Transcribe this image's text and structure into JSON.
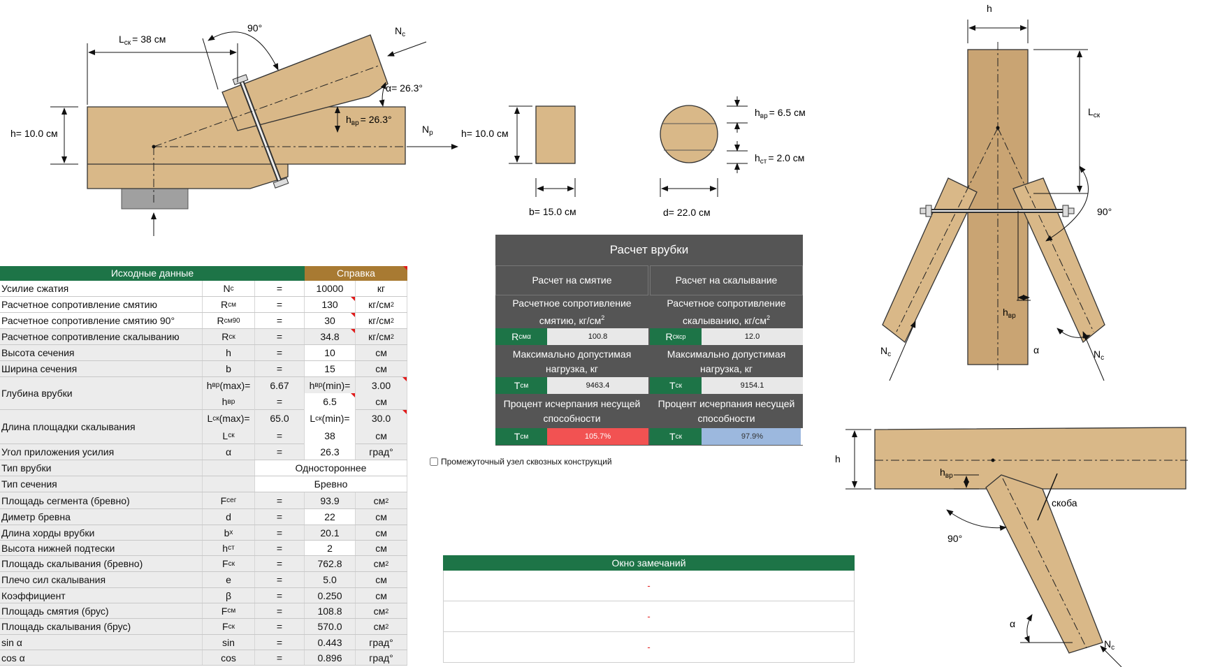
{
  "drawing1": {
    "l_label": "L",
    "l_sub": "ск",
    "l_value": "= 38 см",
    "angle_90": "90°",
    "nc": "N",
    "nc_sub": "c",
    "alpha": "α= 26.3°",
    "h_label": "h=  10.0 см",
    "hvr_label": "h",
    "hvr_sub": "вр",
    "hvr_value": "= 26.3°",
    "np": "N",
    "np_sub": "р"
  },
  "sections": {
    "rect_h": "h=  10.0 см",
    "rect_b": "b= 15.0 см",
    "circle_d": "d= 22.0 см",
    "hvr": "h",
    "hvr_sub": "вр",
    "hvr_value": "= 6.5 см",
    "hst": "h",
    "hst_sub": "ст",
    "hst_value": "= 2.0 см"
  },
  "drawing3": {
    "h": "h",
    "lsk": "L",
    "lsk_sub": "ск",
    "angle": "90°",
    "hvr": "h",
    "hvr_sub": "вр",
    "alpha": "α",
    "nc_left": "N",
    "nc_right": "N",
    "nc_sub": "c"
  },
  "drawing4": {
    "h": "h",
    "hvr": "h",
    "hvr_sub": "вр",
    "skoba": "скоба",
    "angle": "90°",
    "alpha": "α",
    "nc": "N",
    "nc_sub": "c"
  },
  "input": {
    "header": "Исходные данные",
    "help": "Справка",
    "colors": {
      "green": "#1d7447",
      "brown": "#a87a32"
    },
    "rows": {
      "force": {
        "label": "Усилие сжатия",
        "sym": "N",
        "sub": "c",
        "eq": "=",
        "val": "10000",
        "unit": "кг"
      },
      "rsm": {
        "label": "Расчетное сопротивление смятию",
        "sym": "R",
        "sub": "см",
        "eq": "=",
        "val": "130",
        "unit": "кг/см",
        "sup": "2"
      },
      "rsm90": {
        "label": "Расчетное сопротивление смятию 90°",
        "sym": "R",
        "sub": "см90",
        "eq": "=",
        "val": "30",
        "unit": "кг/см",
        "sup": "2"
      },
      "rsk": {
        "label": "Расчетное сопротивление скалыванию",
        "sym": "R",
        "sub": "ск",
        "eq": "=",
        "val": "34.8",
        "unit": "кг/см",
        "sup": "2"
      },
      "h": {
        "label": "Высота сечения",
        "sym": "h",
        "eq": "=",
        "val": "10",
        "unit": "см"
      },
      "b": {
        "label": "Ширина сечения",
        "sym": "b",
        "eq": "=",
        "val": "15",
        "unit": "см"
      },
      "depth": {
        "label": "Глубина врубки",
        "max_sym": "h",
        "max_sub": "вр",
        "max_suffix": "(max)=",
        "max_val": "6.67",
        "min_sym": "h",
        "min_sub": "вр",
        "min_suffix": "(min)=",
        "min_val": "3.00",
        "sym": "h",
        "sub": "вр",
        "eq": "=",
        "val": "6.5",
        "unit": "см"
      },
      "shear_len": {
        "label": "Длина площадки скалывания",
        "max_sym": "L",
        "max_sub": "ск",
        "max_suffix": "(max)=",
        "max_val": "65.0",
        "min_sym": "L",
        "min_sub": "ск",
        "min_suffix": "(min)=",
        "min_val": "30.0",
        "sym": "L",
        "sub": "ск",
        "eq": "=",
        "val": "38",
        "unit": "см"
      },
      "angle": {
        "label": "Угол приложения усилия",
        "sym": "α",
        "eq": "=",
        "val": "26.3",
        "unit": "град°"
      },
      "cut_type": {
        "label": "Тип врубки",
        "val": "Одностороннее"
      },
      "sec_type": {
        "label": "Тип сечения",
        "val": "Бревно"
      },
      "fseg": {
        "label": "Площадь сегмента (бревно)",
        "sym": "F",
        "sub": "сег",
        "eq": "=",
        "val": "93.9",
        "unit": "см",
        "sup": "2"
      },
      "d": {
        "label": "Диметр бревна",
        "sym": "d",
        "eq": "=",
        "val": "22",
        "unit": "см"
      },
      "bx": {
        "label": "Длина хорды врубки",
        "sym": "b",
        "sub": "x",
        "eq": "=",
        "val": "20.1",
        "unit": "см"
      },
      "hst": {
        "label": "Высота нижней подтески",
        "sym": "h",
        "sub": "ст",
        "eq": "=",
        "val": "2",
        "unit": "см"
      },
      "fsk_log": {
        "label": "Площадь скалывания (бревно)",
        "sym": "F",
        "sub": "ск",
        "eq": "=",
        "val": "762.8",
        "unit": "см",
        "sup": "2"
      },
      "e": {
        "label": "Плечо сил скалывания",
        "sym": "e",
        "eq": "=",
        "val": "5.0",
        "unit": "см"
      },
      "beta": {
        "label": "Коэффициент",
        "sym": "β",
        "eq": "=",
        "val": "0.250",
        "unit": "см"
      },
      "fsm": {
        "label": "Площадь смятия (брус)",
        "sym": "F",
        "sub": "см",
        "eq": "=",
        "val": "108.8",
        "unit": "см",
        "sup": "2"
      },
      "fsk_beam": {
        "label": "Площадь скалывания (брус)",
        "sym": "F",
        "sub": "ск",
        "eq": "=",
        "val": "570.0",
        "unit": "см",
        "sup": "2"
      },
      "sin": {
        "label": "sin α",
        "sym": "sin",
        "eq": "=",
        "val": "0.443",
        "unit": "град°"
      },
      "cos": {
        "label": "cos α",
        "sym": "cos",
        "eq": "=",
        "val": "0.896",
        "unit": "град°"
      }
    }
  },
  "calc": {
    "title": "Расчет врубки",
    "col1": "Расчет на смятие",
    "col2": "Расчет на скалывание",
    "res1_l1": "Расчетное сопротивление",
    "res1_l2": "смятию, кг/см",
    "res2_l1": "Расчетное сопротивление",
    "res2_l2": "скалыванию, кг/см",
    "sup2": "2",
    "r_sm_sym": "R",
    "r_sm_sub": "смα",
    "r_sm_val": "100.8",
    "r_sk_sym": "R",
    "r_sk_sub": "ск",
    "r_sk_sup": "ср",
    "r_sk_val": "12.0",
    "max_l1": "Максимально допустимая",
    "max_l2": "нагрузка, кг",
    "t_sm_sym": "T",
    "t_sm_sub": "см",
    "t_sm_val": "9463.4",
    "t_sk_sym": "T",
    "t_sk_sub": "ск",
    "t_sk_val": "9154.1",
    "pct_l1": "Процент исчерпания несущей",
    "pct_l2": "способности",
    "p_sm_sym": "T",
    "p_sm_sub": "см",
    "p_sm_val": "105.7%",
    "p_sm_fill": 1.0,
    "p_sk_sym": "T",
    "p_sk_sub": "ск",
    "p_sk_val": "97.9%",
    "p_sk_fill": 0.979,
    "colors": {
      "panel": "#555555",
      "green": "#1d7447",
      "red": "#f25252",
      "blue": "#9cb8de"
    }
  },
  "checkbox": {
    "label": "Промежуточный узел сквозных конструкций",
    "checked": false
  },
  "remarks": {
    "title": "Окно замечаний",
    "r1": "-",
    "r2": "-",
    "r3": "-"
  }
}
